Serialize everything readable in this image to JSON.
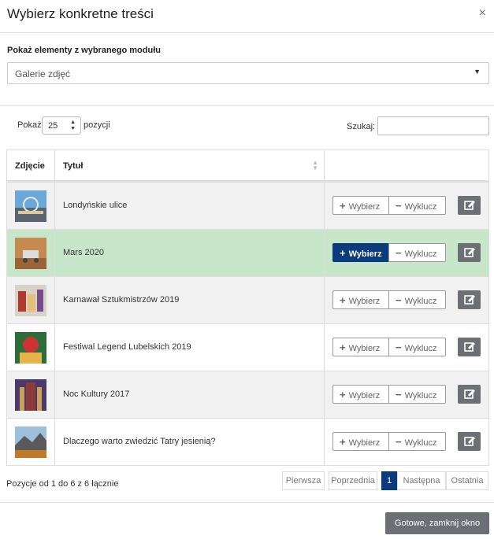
{
  "dialog": {
    "title": "Wybierz konkretne treści",
    "close_glyph": "×"
  },
  "module": {
    "label": "Pokaż elementy z wybranego modułu",
    "selected": "Galerie zdjęć"
  },
  "controls": {
    "show_label": "Pokaż",
    "page_size": "25",
    "positions_label": "pozycji",
    "search_label": "Szukaj:",
    "search_value": ""
  },
  "table": {
    "columns": [
      "Zdjęcie",
      "Tytuł",
      ""
    ],
    "rows": [
      {
        "title": "Londyńskie ulice",
        "selected": false
      },
      {
        "title": "Mars 2020",
        "selected": true
      },
      {
        "title": "Karnawał Sztukmistrzów 2019",
        "selected": false
      },
      {
        "title": "Festiwal Legend Lubelskich 2019",
        "selected": false
      },
      {
        "title": "Noc Kultury 2017",
        "selected": false
      },
      {
        "title": "Dlaczego warto zwiedzić Tatry jesienią?",
        "selected": false
      }
    ],
    "choose_label": "Wybierz",
    "exclude_label": "Wyklucz"
  },
  "footer": {
    "info": "Pozycje od 1 do 6 z 6 łącznie",
    "pagination": [
      "Pierwsza",
      "Poprzednia",
      "1",
      "Następna",
      "Ostatnia"
    ],
    "active_page": "1",
    "done_label": "Gotowe, zamknij okno"
  },
  "colors": {
    "accent": "#0b3a7d",
    "selected_row": "#c8e6c9",
    "edit_button": "#6c6f73"
  }
}
